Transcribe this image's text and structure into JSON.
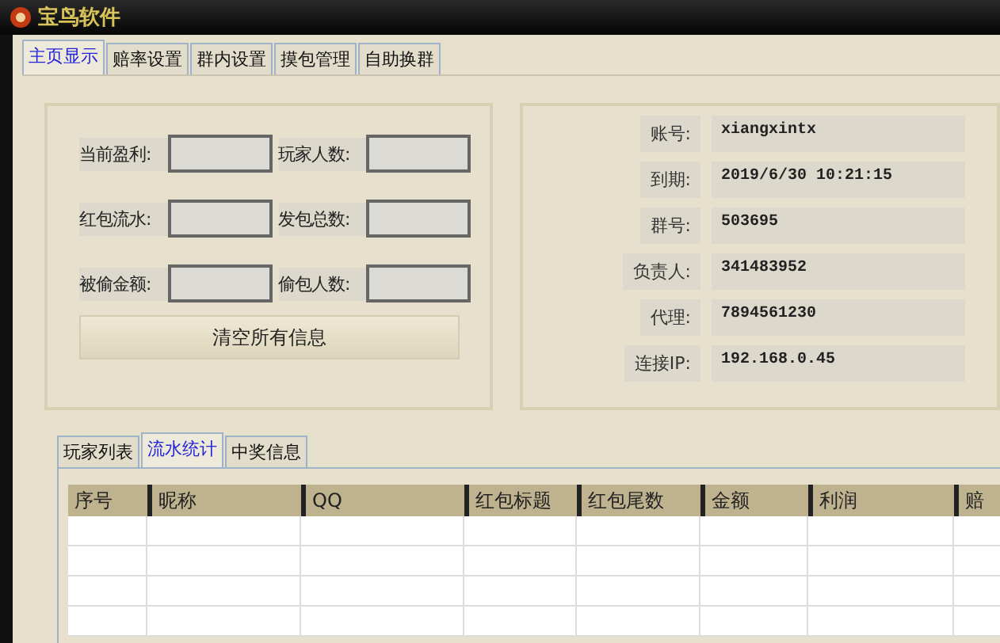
{
  "window": {
    "title": "宝鸟软件"
  },
  "tabs": [
    {
      "label": "主页显示",
      "selected": true
    },
    {
      "label": "赔率设置",
      "selected": false
    },
    {
      "label": "群内设置",
      "selected": false
    },
    {
      "label": "摸包管理",
      "selected": false
    },
    {
      "label": "自助换群",
      "selected": false
    }
  ],
  "stats": [
    {
      "label": "当前盈利:"
    },
    {
      "label": "玩家人数:"
    },
    {
      "label": "红包流水:"
    },
    {
      "label": "发包总数:"
    },
    {
      "label": "被偷金额:"
    },
    {
      "label": "偷包人数:"
    }
  ],
  "clear_button": "清空所有信息",
  "account": [
    {
      "label": "账号:",
      "value": "xiangxintx"
    },
    {
      "label": "到期:",
      "value": "2019/6/30 10:21:15"
    },
    {
      "label": "群号:",
      "value": "503695"
    },
    {
      "label": "负责人:",
      "value": "341483952"
    },
    {
      "label": "代理:",
      "value": "7894561230"
    },
    {
      "label": "连接IP:",
      "value": "192.168.0.45"
    }
  ],
  "sub_tabs": [
    {
      "label": "玩家列表",
      "selected": false
    },
    {
      "label": "流水统计",
      "selected": true
    },
    {
      "label": "中奖信息",
      "selected": false
    }
  ],
  "table": {
    "columns": [
      "序号",
      "昵称",
      "QQ",
      "红包标题",
      "红包尾数",
      "金额",
      "利润",
      "赔"
    ]
  }
}
